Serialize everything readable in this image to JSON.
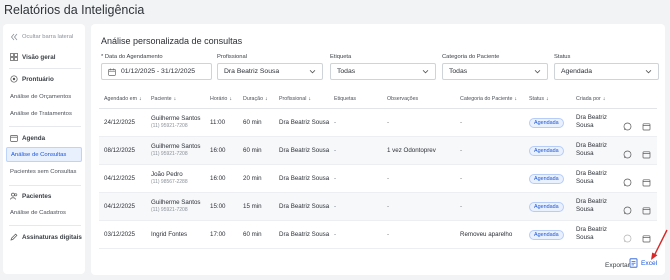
{
  "page": {
    "title": "Relatórios da Inteligência"
  },
  "sidebar": {
    "collapse_label": "Ocultar barra lateral",
    "items": [
      {
        "label": "Visão geral"
      },
      {
        "label": "Prontuário"
      },
      {
        "label": "Análise de Orçamentos"
      },
      {
        "label": "Análise de Tratamentos"
      },
      {
        "label": "Agenda"
      },
      {
        "label": "Análise de Consultas"
      },
      {
        "label": "Pacientes sem Consultas"
      },
      {
        "label": "Pacientes"
      },
      {
        "label": "Análise de Cadastros"
      },
      {
        "label": "Assinaturas digitais"
      }
    ]
  },
  "main": {
    "title": "Análise personalizada de consultas",
    "filters": {
      "date": {
        "label": "* Data do Agendamento",
        "value": "01/12/2025 - 31/12/2025"
      },
      "professional": {
        "label": "Profissional",
        "value": "Dra Beatriz Sousa"
      },
      "tag": {
        "label": "Etiqueta",
        "value": "Todas"
      },
      "category": {
        "label": "Categoria do Paciente",
        "value": "Todas"
      },
      "status": {
        "label": "Status",
        "value": "Agendada"
      }
    },
    "table": {
      "headers": [
        "Agendado em",
        "Paciente",
        "Horário",
        "Duração",
        "Profissional",
        "Etiquetas",
        "Observações",
        "Categoria do Paciente",
        "Status",
        "Criada por"
      ],
      "rows": [
        {
          "date": "24/12/2025",
          "patient": "Guilherme Santos",
          "phone": "(11) 95921-7208",
          "time": "11:00",
          "duration": "60 min",
          "professional": "Dra Beatriz Sousa",
          "tags": "-",
          "notes": "-",
          "category": "-",
          "status": "Agendada",
          "created_by": "Dra Beatriz Sousa"
        },
        {
          "date": "08/12/2025",
          "patient": "Guilherme Santos",
          "phone": "(11) 95921-7208",
          "time": "16:00",
          "duration": "60 min",
          "professional": "Dra Beatriz Sousa",
          "tags": "-",
          "notes": "1 vez Odontoprev",
          "category": "-",
          "status": "Agendada",
          "created_by": "Dra Beatriz Sousa"
        },
        {
          "date": "04/12/2025",
          "patient": "João Pedro",
          "phone": "(11) 98567-2288",
          "time": "16:00",
          "duration": "20 min",
          "professional": "Dra Beatriz Sousa",
          "tags": "-",
          "notes": "-",
          "category": "-",
          "status": "Agendada",
          "created_by": "Dra Beatriz Sousa"
        },
        {
          "date": "04/12/2025",
          "patient": "Guilherme Santos",
          "phone": "(11) 95921-7208",
          "time": "15:00",
          "duration": "15 min",
          "professional": "Dra Beatriz Sousa",
          "tags": "-",
          "notes": "-",
          "category": "-",
          "status": "Agendada",
          "created_by": "Dra Beatriz Sousa"
        },
        {
          "date": "03/12/2025",
          "patient": "Ingrid Fontes",
          "phone": "",
          "time": "17:00",
          "duration": "60 min",
          "professional": "Dra Beatriz Sousa",
          "tags": "-",
          "notes": "-",
          "category": "Removeu aparelho",
          "status": "Agendada",
          "created_by": "Dra Beatriz Sousa"
        }
      ]
    },
    "footer": {
      "export_label": "Exportar",
      "excel_label": "Excel"
    }
  },
  "colors": {
    "accent": "#1a56db",
    "annotation_arrow": "#d62828"
  }
}
